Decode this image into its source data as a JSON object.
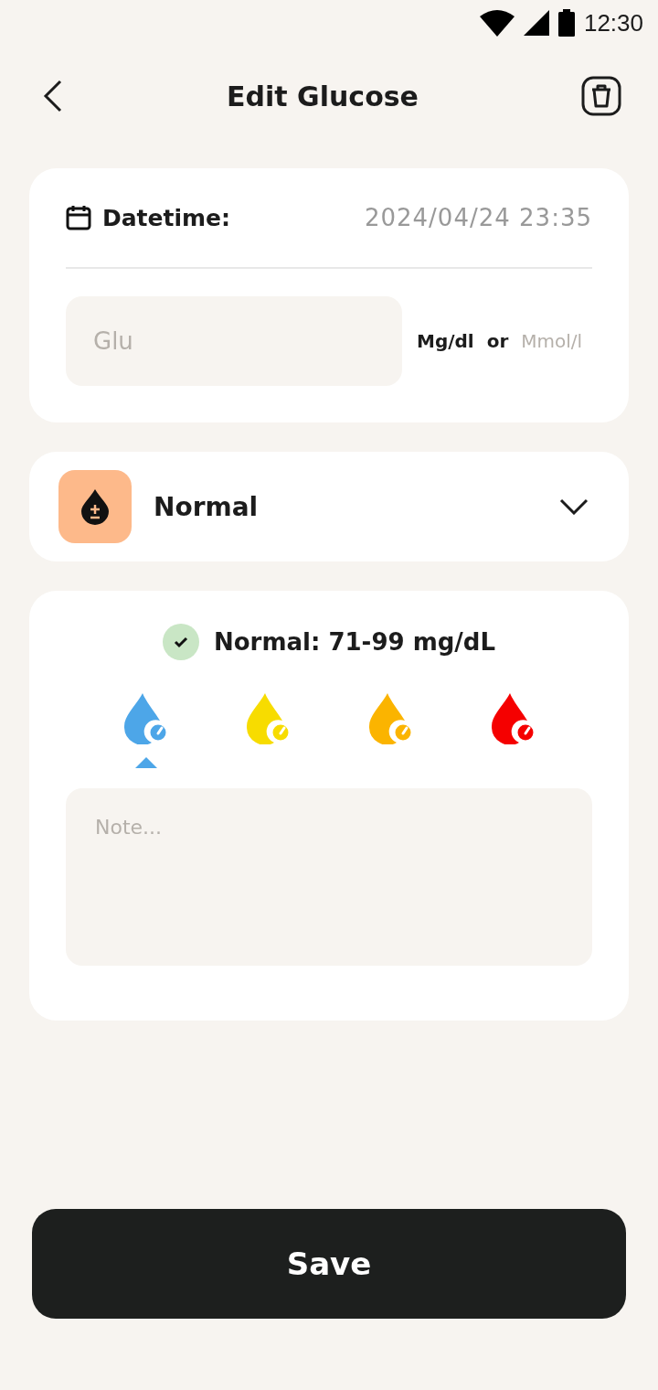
{
  "status_bar": {
    "time": "12:30"
  },
  "header": {
    "title": "Edit Glucose"
  },
  "datetime": {
    "label": "Datetime:",
    "value": "2024/04/24 23:35"
  },
  "glucose_field": {
    "placeholder": "Glu"
  },
  "units": [
    {
      "label": "Mg/dl",
      "selected": true
    },
    {
      "label": "Mmol/l",
      "selected": false
    }
  ],
  "units_separator": "or",
  "condition": {
    "label": "Normal"
  },
  "range": {
    "text": "Normal: 71-99 mg/dL"
  },
  "levels": [
    {
      "color": "#4da6e8",
      "selected": true
    },
    {
      "color": "#f7dc00",
      "selected": false
    },
    {
      "color": "#fbb400",
      "selected": false
    },
    {
      "color": "#f50000",
      "selected": false
    }
  ],
  "note": {
    "placeholder": "Note..."
  },
  "save_button": "Save"
}
